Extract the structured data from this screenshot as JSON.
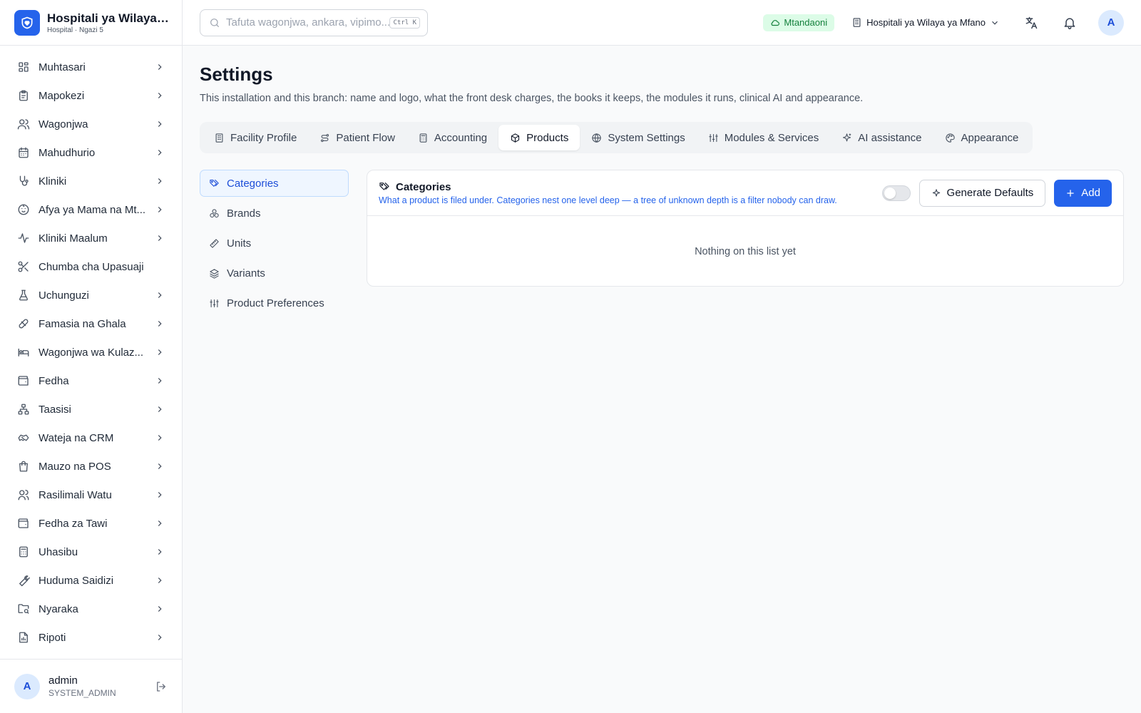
{
  "brand": {
    "name": "Hospitali ya Wilaya ...",
    "subtitle": "Hospital · Ngazi 5",
    "icon": "heart-shield-icon",
    "color": "#2563eb"
  },
  "sidebar": {
    "items": [
      {
        "label": "Muhtasari",
        "icon": "dashboard-icon",
        "has_children": true
      },
      {
        "label": "Mapokezi",
        "icon": "clipboard-icon",
        "has_children": true
      },
      {
        "label": "Wagonjwa",
        "icon": "users-icon",
        "has_children": true
      },
      {
        "label": "Mahudhurio",
        "icon": "calendar-icon",
        "has_children": true
      },
      {
        "label": "Kliniki",
        "icon": "stethoscope-icon",
        "has_children": true
      },
      {
        "label": "Afya ya Mama na Mt...",
        "icon": "baby-icon",
        "has_children": true
      },
      {
        "label": "Kliniki Maalum",
        "icon": "activity-icon",
        "has_children": true
      },
      {
        "label": "Chumba cha Upasuaji",
        "icon": "scissors-icon",
        "has_children": false
      },
      {
        "label": "Uchunguzi",
        "icon": "flask-icon",
        "has_children": true
      },
      {
        "label": "Famasia na Ghala",
        "icon": "pill-icon",
        "has_children": true
      },
      {
        "label": "Wagonjwa wa Kulaz...",
        "icon": "bed-icon",
        "has_children": true
      },
      {
        "label": "Fedha",
        "icon": "wallet-icon",
        "has_children": true
      },
      {
        "label": "Taasisi",
        "icon": "network-icon",
        "has_children": true
      },
      {
        "label": "Wateja na CRM",
        "icon": "handshake-icon",
        "has_children": true
      },
      {
        "label": "Mauzo na POS",
        "icon": "shopping-bag-icon",
        "has_children": true
      },
      {
        "label": "Rasilimali Watu",
        "icon": "user-group-icon",
        "has_children": true
      },
      {
        "label": "Fedha za Tawi",
        "icon": "wallet-icon",
        "has_children": true
      },
      {
        "label": "Uhasibu",
        "icon": "calculator-icon",
        "has_children": true
      },
      {
        "label": "Huduma Saidizi",
        "icon": "wrench-icon",
        "has_children": true
      },
      {
        "label": "Nyaraka",
        "icon": "folder-search-icon",
        "has_children": true
      },
      {
        "label": "Ripoti",
        "icon": "file-chart-icon",
        "has_children": true
      }
    ]
  },
  "user": {
    "initial": "A",
    "name": "admin",
    "role": "SYSTEM_ADMIN"
  },
  "topbar": {
    "search_placeholder": "Tafuta wagonjwa, ankara, vipimo...",
    "search_shortcut": "Ctrl K",
    "status": "Mtandaoni",
    "status_color": "#15803d",
    "branch": "Hospitali ya Wilaya ya Mfano",
    "avatar_initial": "A"
  },
  "page": {
    "title": "Settings",
    "description": "This installation and this branch: name and logo, what the front desk charges, the books it keeps, the modules it runs, clinical AI and appearance."
  },
  "tabs": [
    {
      "label": "Facility Profile",
      "icon": "building-icon",
      "active": false
    },
    {
      "label": "Patient Flow",
      "icon": "route-icon",
      "active": false
    },
    {
      "label": "Accounting",
      "icon": "calculator-icon",
      "active": false
    },
    {
      "label": "Products",
      "icon": "package-icon",
      "active": true
    },
    {
      "label": "System Settings",
      "icon": "globe-icon",
      "active": false
    },
    {
      "label": "Modules & Services",
      "icon": "sliders-icon",
      "active": false
    },
    {
      "label": "AI assistance",
      "icon": "sparkles-icon",
      "active": false
    },
    {
      "label": "Appearance",
      "icon": "palette-icon",
      "active": false
    }
  ],
  "subnav": [
    {
      "label": "Categories",
      "icon": "tags-icon",
      "active": true
    },
    {
      "label": "Brands",
      "icon": "brands-icon",
      "active": false
    },
    {
      "label": "Units",
      "icon": "ruler-icon",
      "active": false
    },
    {
      "label": "Variants",
      "icon": "layers-icon",
      "active": false
    },
    {
      "label": "Product Preferences",
      "icon": "sliders-icon",
      "active": false
    }
  ],
  "panel": {
    "title": "Categories",
    "subtitle": "What a product is filed under. Categories nest one level deep — a tree of unknown depth is a filter nobody can draw.",
    "toggle_on": false,
    "generate_label": "Generate Defaults",
    "add_label": "Add",
    "empty_text": "Nothing on this list yet",
    "accent_color": "#2563eb"
  }
}
